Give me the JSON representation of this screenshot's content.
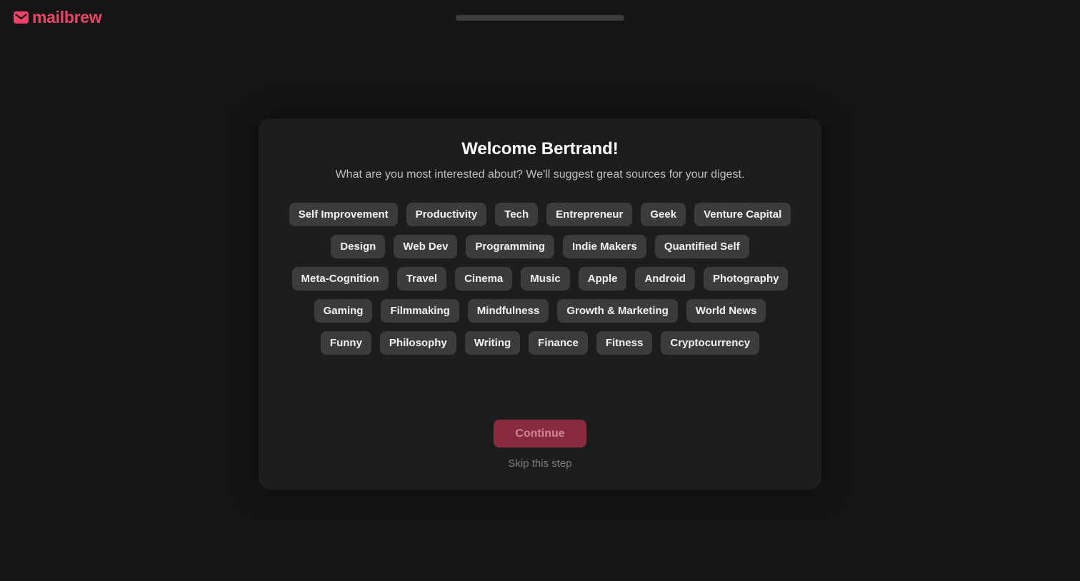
{
  "header": {
    "brand_name": "mailbrew",
    "brand_color": "#f0436a",
    "logo_icon": "envelope-icon",
    "progress_fraction": 0.0
  },
  "onboarding": {
    "title": "Welcome Bertrand!",
    "subtitle": "What are you most interested about? We'll suggest great sources for your digest.",
    "tag_rows": [
      [
        "Self Improvement",
        "Productivity",
        "Tech",
        "Entrepreneur",
        "Geek",
        "Venture Capital"
      ],
      [
        "Design",
        "Web Dev",
        "Programming",
        "Indie Makers",
        "Quantified Self"
      ],
      [
        "Meta-Cognition",
        "Travel",
        "Cinema",
        "Music",
        "Apple",
        "Android",
        "Photography"
      ],
      [
        "Gaming",
        "Filmmaking",
        "Mindfulness",
        "Growth & Marketing",
        "World News"
      ],
      [
        "Funny",
        "Philosophy",
        "Writing",
        "Finance",
        "Fitness",
        "Cryptocurrency"
      ]
    ],
    "continue_label": "Continue",
    "continue_disabled": true,
    "skip_label": "Skip this step"
  }
}
